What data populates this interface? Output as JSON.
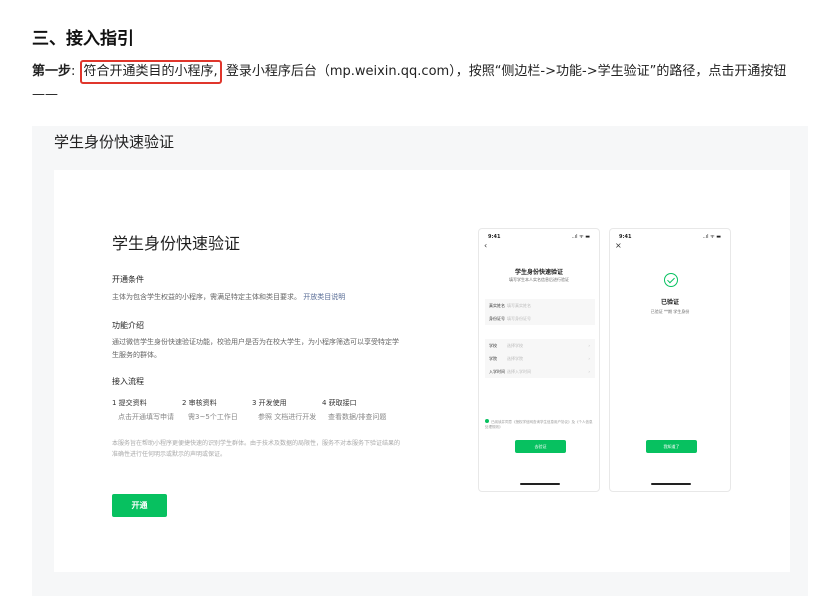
{
  "heading": "三、接入指引",
  "step": {
    "label": "第一步",
    "colon": ":",
    "highlight": "符合开通类目的小程序,",
    "text": "登录小程序后台（mp.weixin.qq.com），按照“侧边栏->功能->学生验证”的路径，点击开通按钮——"
  },
  "panel": {
    "title": "学生身份快速验证",
    "card": {
      "title": "学生身份快速验证",
      "conditions_title": "开通条件",
      "conditions_text": "主体为包含学生权益的小程序，需满足特定主体和类目要求。",
      "conditions_link": "开放类目说明",
      "intro_title": "功能介绍",
      "intro_text": "通过微信学生身份快速验证功能，校验用户是否为在校大学生，为小程序筛选可以享受特定学生服务的群体。",
      "flow_title": "接入流程",
      "flow": [
        {
          "step": "1 提交资料",
          "sub": "点击开通填写申请"
        },
        {
          "step": "2 审核资料",
          "sub": "需3~5个工作日"
        },
        {
          "step": "3 开发使用",
          "sub": "参照 文档进行开发"
        },
        {
          "step": "4 获取接口",
          "sub": "查看数据/排查问题"
        }
      ],
      "note": "本服务旨在帮助小程序更便捷快速的识别学生群体。由于技术及数据的局限性，服务不对本服务下验证结果的准确性进行任何明示或默示的声明或保证。",
      "open_button": "开通"
    },
    "phone1": {
      "time": "9:41",
      "status": "..ıl ᯤ ▬",
      "back": "‹",
      "title": "学生身份快速验证",
      "subtitle": "填写学生本人实名信息后进行验证",
      "fields1": [
        {
          "label": "真实姓名",
          "placeholder": "填写真实姓名"
        },
        {
          "label": "身份证号",
          "placeholder": "填写身份证号"
        }
      ],
      "fields2": [
        {
          "label": "学校",
          "placeholder": "选择学校"
        },
        {
          "label": "学院",
          "placeholder": "选择学院"
        },
        {
          "label": "入学时间",
          "placeholder": "选择入学时间"
        }
      ],
      "agreement": "已阅读并同意《授权学信网查询学生信息用户协议》及《个人信息处理规则》",
      "button": "去验证"
    },
    "phone2": {
      "time": "9:41",
      "status": "..ıl ᯤ ▬",
      "close": "×",
      "title": "已验证",
      "subtitle": "已验证 **期 学生身份",
      "button": "我知道了"
    }
  },
  "colors": {
    "accent": "#07c160",
    "highlight_border": "#e0362c",
    "link": "#576b95"
  }
}
